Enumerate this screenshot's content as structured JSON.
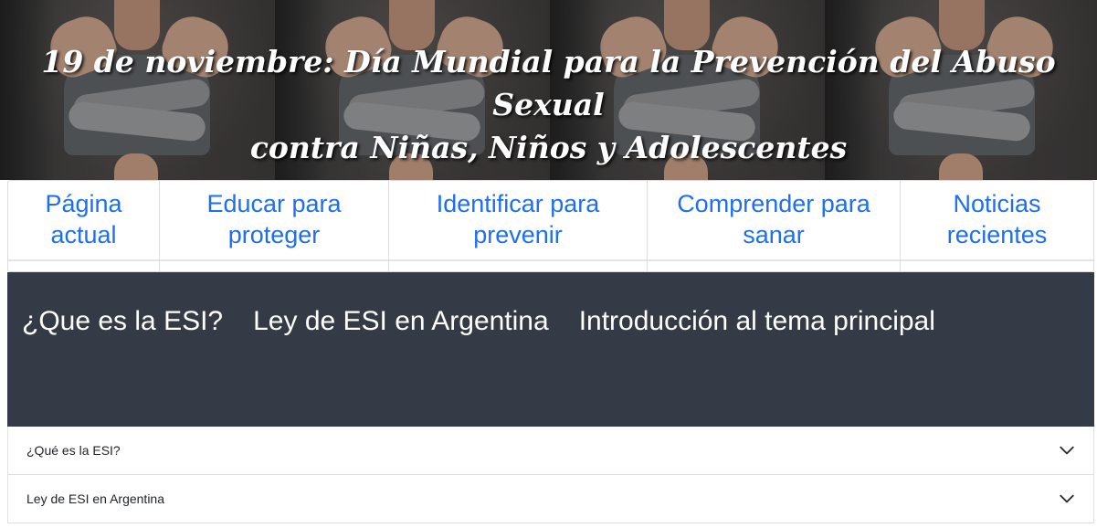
{
  "banner": {
    "title_line1": "19 de noviembre: Día Mundial para la Prevención del Abuso Sexual",
    "title_line2": "contra Niñas, Niños y Adolescentes"
  },
  "topnav": {
    "items": [
      {
        "line1": "Página",
        "line2": "actual"
      },
      {
        "line1": "Educar para",
        "line2": "proteger"
      },
      {
        "line1": "Identificar para",
        "line2": "prevenir"
      },
      {
        "line1": "Comprender para",
        "line2": "sanar"
      },
      {
        "line1": "Noticias",
        "line2": "recientes"
      }
    ]
  },
  "section_nav": {
    "links": [
      "¿Que es la ESI?",
      "Ley de ESI en Argentina",
      "Introducción al tema principal"
    ]
  },
  "accordion": {
    "items": [
      {
        "label": "¿Qué es la ESI?",
        "icon": "chevron-down-icon"
      },
      {
        "label": "Ley de ESI en Argentina",
        "icon": "chevron-down-icon"
      }
    ]
  },
  "colors": {
    "link": "#1e6ff0",
    "dark_section": "#343a46",
    "banner_text": "#ffffff"
  }
}
